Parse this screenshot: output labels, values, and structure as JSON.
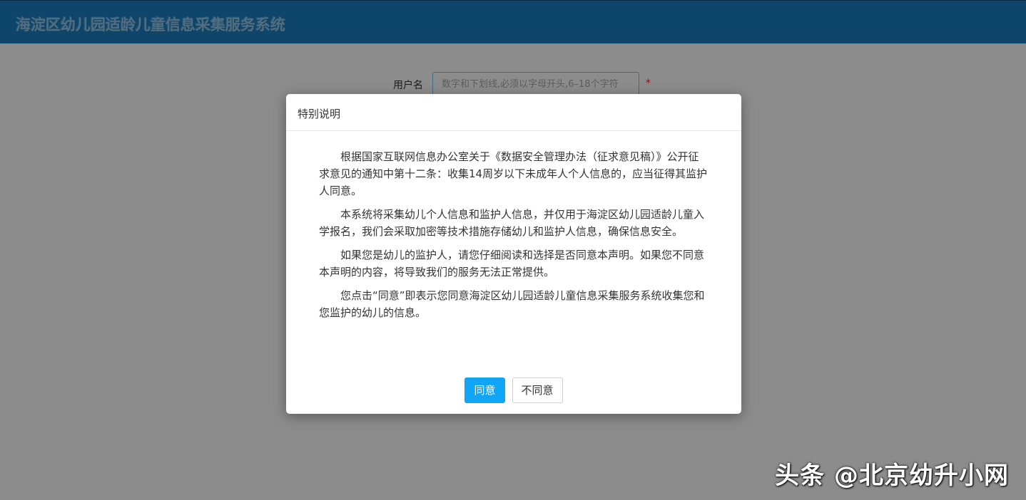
{
  "header": {
    "title": "海淀区幼儿园适龄儿童信息采集服务系统"
  },
  "form": {
    "username_label": "用户名",
    "username_placeholder": "数字和下划线,必须以字母开头,6–18个字符",
    "required_mark": "*"
  },
  "modal": {
    "title": "特别说明",
    "paragraphs": [
      "根据国家互联网信息办公室关于《数据安全管理办法（征求意见稿）》公开征求意见的通知中第十二条：收集14周岁以下未成年人个人信息的，应当征得其监护人同意。",
      "本系统将采集幼儿个人信息和监护人信息，并仅用于海淀区幼儿园适龄儿童入学报名，我们会采取加密等技术措施存储幼儿和监护人信息，确保信息安全。",
      "如果您是幼儿的监护人，请您仔细阅读和选择是否同意本声明。如果您不同意本声明的内容，将导致我们的服务无法正常提供。",
      "您点击“同意”即表示您同意海淀区幼儿园适龄儿童信息采集服务系统收集您和您监护的幼儿的信息。"
    ],
    "agree_label": "同意",
    "disagree_label": "不同意"
  },
  "watermark": {
    "text": "头条 @北京幼升小网"
  },
  "colors": {
    "header_bg": "#1a80c4",
    "primary_button": "#10a5f5",
    "required": "#e03030"
  }
}
